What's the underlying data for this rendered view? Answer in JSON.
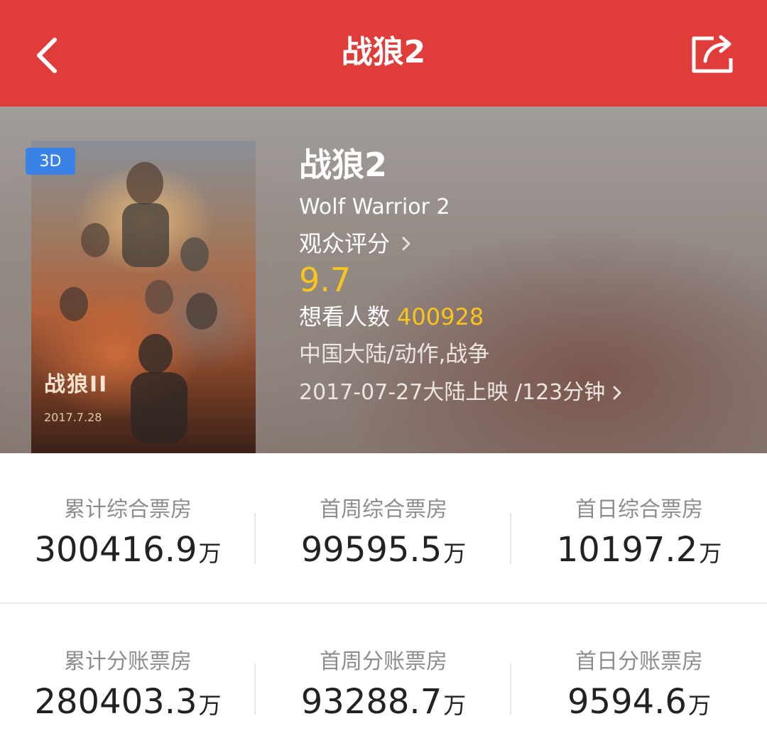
{
  "header": {
    "title": "战狼2",
    "icons": {
      "back": "back-arrow-icon",
      "share": "share-icon"
    }
  },
  "movie": {
    "badge": "3D",
    "title": "战狼2",
    "english_title": "Wolf Warrior 2",
    "score_label": "观众评分",
    "score": "9.7",
    "want_label": "想看人数",
    "want_count": "400928",
    "genre": "中国大陆/动作,战争",
    "release": "2017-07-27大陆上映 /123分钟",
    "poster": {
      "date": "2017.7.28"
    }
  },
  "box_office": {
    "unit": "万",
    "rows": [
      [
        {
          "label": "累计综合票房",
          "value": "300416.9"
        },
        {
          "label": "首周综合票房",
          "value": "99595.5"
        },
        {
          "label": "首日综合票房",
          "value": "10197.2"
        }
      ],
      [
        {
          "label": "累计分账票房",
          "value": "280403.3"
        },
        {
          "label": "首周分账票房",
          "value": "93288.7"
        },
        {
          "label": "首日分账票房",
          "value": "9594.6"
        }
      ]
    ]
  },
  "colors": {
    "header_bg": "#e03c3a",
    "score": "#f8c51c",
    "badge": "#3b82e6"
  }
}
